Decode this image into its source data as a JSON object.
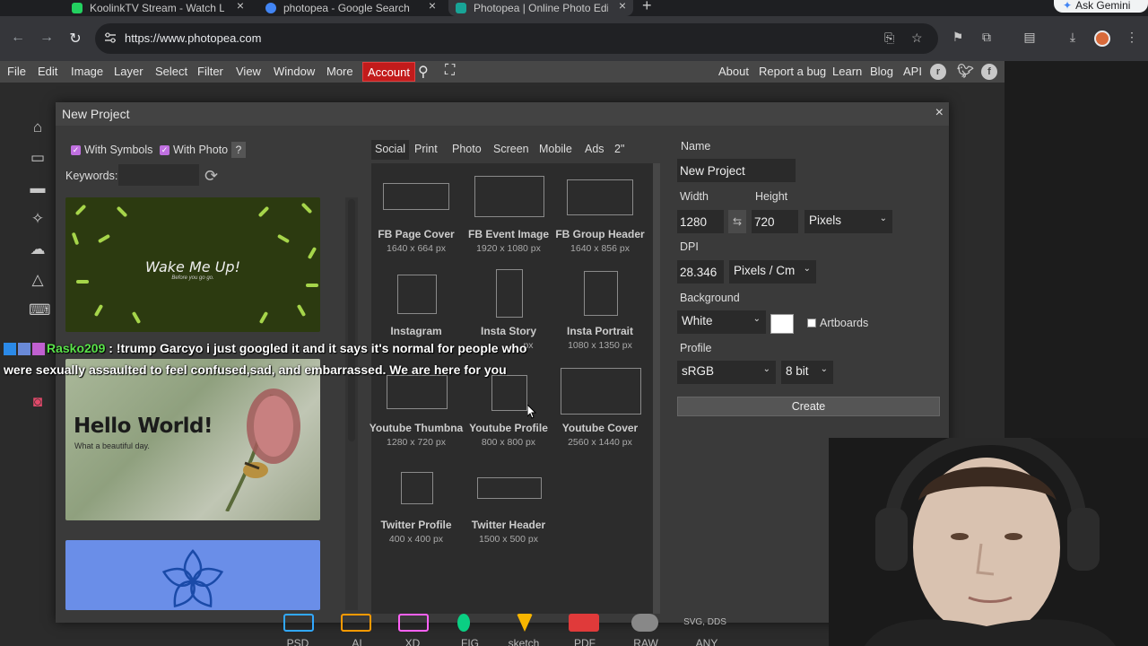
{
  "browser": {
    "tabs": [
      {
        "title": "KoolinkTV Stream - Watch Li",
        "favicon_color": "#23d160"
      },
      {
        "title": "photopea - Google Search",
        "favicon_color": "#4285f4"
      },
      {
        "title": "Photopea | Online Photo Edit",
        "favicon_color": "#18a497"
      }
    ],
    "new_tab": "+",
    "gemini_label": "Ask Gemini",
    "url": "https://www.photopea.com"
  },
  "menubar": {
    "items": [
      "File",
      "Edit",
      "Image",
      "Layer",
      "Select",
      "Filter",
      "View",
      "Window",
      "More"
    ],
    "account": "Account",
    "right_items": [
      "About",
      "Report a bug",
      "Learn",
      "Blog",
      "API"
    ]
  },
  "dialog": {
    "title": "New Project",
    "close": "×",
    "with_symbols": "With Symbols",
    "with_photo": "With Photo",
    "help": "?",
    "keywords_label": "Keywords:",
    "keywords_value": "",
    "templates": [
      {
        "title": "Wake Me Up!",
        "subtitle": "Before you go go."
      },
      {
        "title": "Hello World!",
        "subtitle": "What a beautiful day."
      }
    ],
    "categories": [
      "Social",
      "Print",
      "Photo",
      "Screen",
      "Mobile",
      "Ads",
      "2\""
    ],
    "active_category": "Social",
    "presets": [
      {
        "name": "FB Page Cover",
        "size": "1640 x 664 px"
      },
      {
        "name": "FB Event Image",
        "size": "1920 x 1080 px"
      },
      {
        "name": "FB Group Header",
        "size": "1640 x 856 px"
      },
      {
        "name": "Instagram",
        "size": ""
      },
      {
        "name": "Insta Story",
        "size": "px"
      },
      {
        "name": "Insta Portrait",
        "size": "1080 x 1350 px"
      },
      {
        "name": "Youtube Thumbna",
        "size": "1280 x 720 px"
      },
      {
        "name": "Youtube Profile",
        "size": "800 x 800 px"
      },
      {
        "name": "Youtube Cover",
        "size": "2560 x 1440 px"
      },
      {
        "name": "Twitter Profile",
        "size": "400 x 400 px"
      },
      {
        "name": "Twitter Header",
        "size": "1500 x 500 px"
      }
    ],
    "form": {
      "name_label": "Name",
      "name_value": "New Project",
      "width_label": "Width",
      "width_value": "1280",
      "height_label": "Height",
      "height_value": "720",
      "unit": "Pixels",
      "link_icon": "⇆",
      "dpi_label": "DPI",
      "dpi_value": "28.346",
      "dpi_unit": "Pixels / Cm",
      "background_label": "Background",
      "background_value": "White",
      "artboards_label": "Artboards",
      "profile_label": "Profile",
      "profile_value": "sRGB",
      "bit_value": "8 bit",
      "create_label": "Create"
    }
  },
  "chat": {
    "user": "Rasko209",
    "message": " : !trump Garcyo i just googled it and it says it's normal for people who were sexually assaulted to feel confused,sad, and embarrassed. We are here for you"
  },
  "formats": {
    "labels": [
      "PSD",
      "AI",
      "XD",
      "FIG",
      "sketch",
      "PDF",
      "RAW",
      "ANY"
    ],
    "last_caption": "SVG, DDS",
    "colors": [
      "#31a8ff",
      "#ff9a00",
      "#ff61f6",
      "#0acf83",
      "#f7b500",
      "#e03a3a",
      "#888888",
      "#333333"
    ]
  }
}
